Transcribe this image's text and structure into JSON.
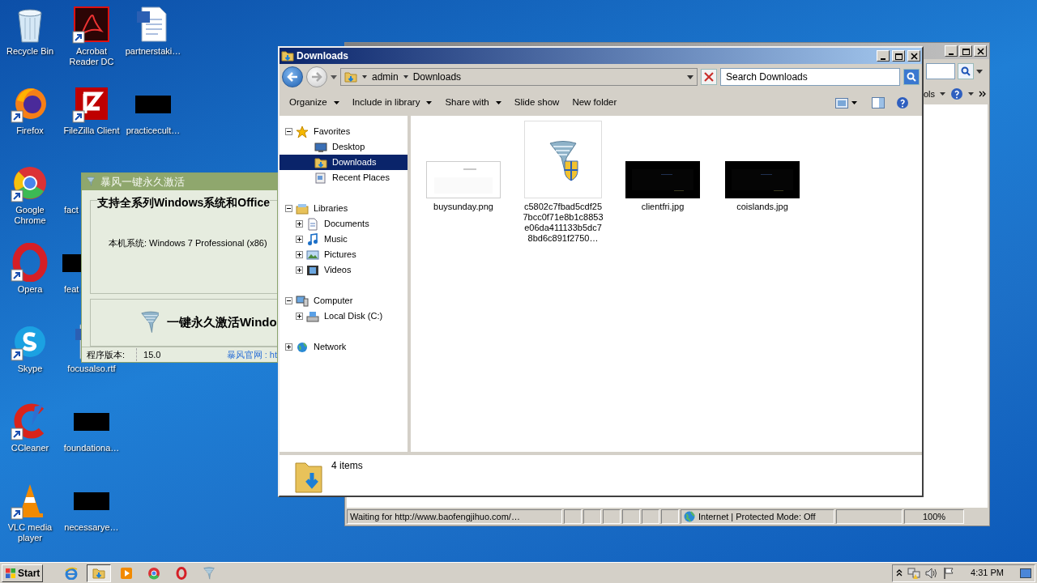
{
  "desktop_icons": [
    {
      "label": "Recycle Bin",
      "kind": "recycle-bin",
      "shortcut": false
    },
    {
      "label": "Firefox",
      "kind": "firefox",
      "shortcut": true
    },
    {
      "label": "Google Chrome",
      "kind": "chrome",
      "shortcut": true
    },
    {
      "label": "Opera",
      "kind": "opera",
      "shortcut": true
    },
    {
      "label": "Skype",
      "kind": "skype",
      "shortcut": true
    },
    {
      "label": "CCleaner",
      "kind": "ccleaner",
      "shortcut": true
    },
    {
      "label": "VLC media player",
      "kind": "vlc",
      "shortcut": true
    },
    {
      "label": "Acrobat Reader DC",
      "kind": "acrobat",
      "shortcut": true
    },
    {
      "label": "FileZilla Client",
      "kind": "filezilla",
      "shortcut": true
    },
    {
      "label": "fact",
      "cut": true
    },
    {
      "label": "feat",
      "kind": "redacted",
      "cut": true
    },
    {
      "label": "focusalso.rtf",
      "kind": "word-doc",
      "shortcut": false
    },
    {
      "label": "foundationa…",
      "kind": "redacted"
    },
    {
      "label": "necessarye…",
      "kind": "redacted"
    },
    {
      "label": "partnerstaki…",
      "kind": "word-doc",
      "shortcut": false
    },
    {
      "label": "practicecult…",
      "kind": "redacted"
    }
  ],
  "activator_window": {
    "title": "暴风一键永久激活",
    "headline": "支持全系列Windows系统和Office",
    "system_info": "本机系统:  Windows 7 Professional (x86)",
    "activate_button": "一键永久激活Windo",
    "version_label": "程序版本:",
    "version": "15.0",
    "site_link": "暴风官网 : ht"
  },
  "ie_window": {
    "menu_fragment": "ols",
    "status_text": "Waiting for http://www.baofengjihuo.com/…",
    "zone": "Internet | Protected Mode: Off",
    "zoom": "100%"
  },
  "explorer": {
    "title": "Downloads",
    "breadcrumb": [
      "admin",
      "Downloads"
    ],
    "search_placeholder": "Search Downloads",
    "toolbar": [
      {
        "label": "Organize",
        "dropdown": true
      },
      {
        "label": "Include in library",
        "dropdown": true
      },
      {
        "label": "Share with",
        "dropdown": true
      },
      {
        "label": "Slide show",
        "dropdown": false
      },
      {
        "label": "New folder",
        "dropdown": false
      }
    ],
    "nav_tree": [
      {
        "label": "Favorites",
        "expanded": true,
        "selected": false,
        "children": [
          {
            "label": "Desktop",
            "selected": false
          },
          {
            "label": "Downloads",
            "selected": true
          },
          {
            "label": "Recent Places",
            "selected": false
          }
        ]
      },
      {
        "label": "Libraries",
        "expanded": true,
        "selected": false,
        "children": [
          {
            "label": "Documents",
            "expanded": false,
            "selected": false
          },
          {
            "label": "Music",
            "expanded": false,
            "selected": false
          },
          {
            "label": "Pictures",
            "expanded": false,
            "selected": false
          },
          {
            "label": "Videos",
            "expanded": false,
            "selected": false
          }
        ]
      },
      {
        "label": "Computer",
        "expanded": true,
        "selected": false,
        "children": [
          {
            "label": "Local Disk (C:)",
            "expanded": false,
            "selected": false
          }
        ]
      },
      {
        "label": "Network",
        "expanded": false,
        "selected": false
      }
    ],
    "files": [
      {
        "name": "buysunday.png"
      },
      {
        "name": "c5802c7fbad5cdf257bcc0f71e8b1c8853e06da411133b5dc78bd6c891f2750…"
      },
      {
        "name": "clientfri.jpg"
      },
      {
        "name": "coislands.jpg"
      }
    ],
    "details": "4 items"
  },
  "taskbar": {
    "start": "Start",
    "buttons": [
      {
        "kind": "ie",
        "active": false
      },
      {
        "kind": "explorer",
        "active": true
      },
      {
        "kind": "media",
        "active": false
      },
      {
        "kind": "chrome",
        "active": false
      },
      {
        "kind": "opera",
        "active": false
      },
      {
        "kind": "tornado",
        "active": false
      }
    ],
    "clock": "4:31 PM"
  }
}
